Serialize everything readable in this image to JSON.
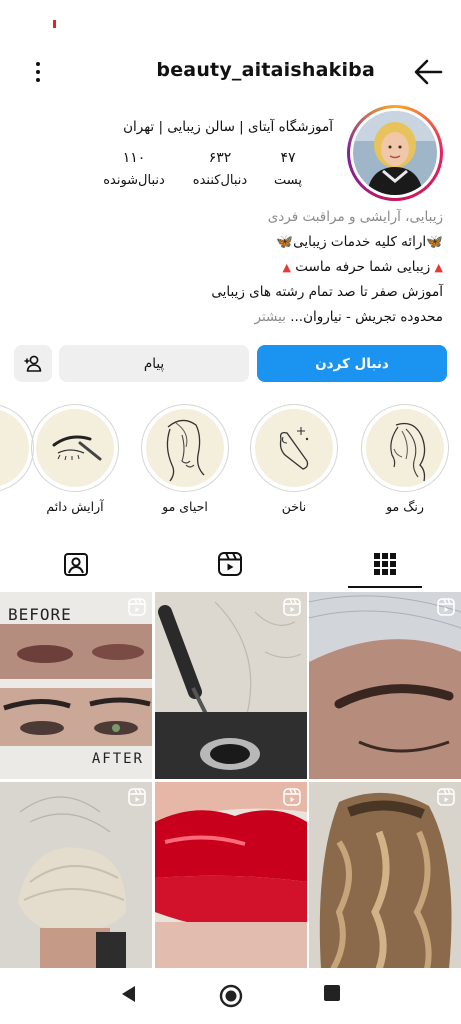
{
  "header": {
    "username": "beauty_aitaishakiba"
  },
  "profile": {
    "title": "آموزشگاه آیتای | سالن زیبایی | تهران",
    "stats": [
      {
        "value": "۴۷",
        "label": "پست"
      },
      {
        "value": "۶۳۲",
        "label": "دنبال‌کننده"
      },
      {
        "value": "۱۱۰",
        "label": "دنبال‌شونده"
      }
    ]
  },
  "bio": {
    "category": "زیبایی، آرایشی و مراقبت فردی",
    "line1": "ارائه کلیه خدمات زیبایی",
    "line2": "زیبایی شما حرفه ماست",
    "line3": "آموزش صفر تا صد تمام رشته های زیبایی",
    "line4": "محدوده تجریش - نیاروان...",
    "more": "بیشتر"
  },
  "actions": {
    "follow": "دنبال کردن",
    "message": "پیام"
  },
  "highlights": [
    {
      "label": "رنگ مو"
    },
    {
      "label": "ناخن"
    },
    {
      "label": "احیای مو"
    },
    {
      "label": "آرایش دائم"
    }
  ],
  "posts": {
    "before_text": "BEFORE",
    "after_text": "AFTER"
  },
  "icons": {
    "menu": "more-vert-icon",
    "back": "arrow-back-icon",
    "add_user": "person-add-icon",
    "grid_tab": "grid-icon",
    "reels_tab": "reels-icon",
    "tagged_tab": "tagged-icon",
    "reel_badge": "reel-icon"
  },
  "colors": {
    "follow_button": "#1b93f0",
    "secondary_button": "#efefef",
    "secondary_text": "#8a8a8a"
  }
}
